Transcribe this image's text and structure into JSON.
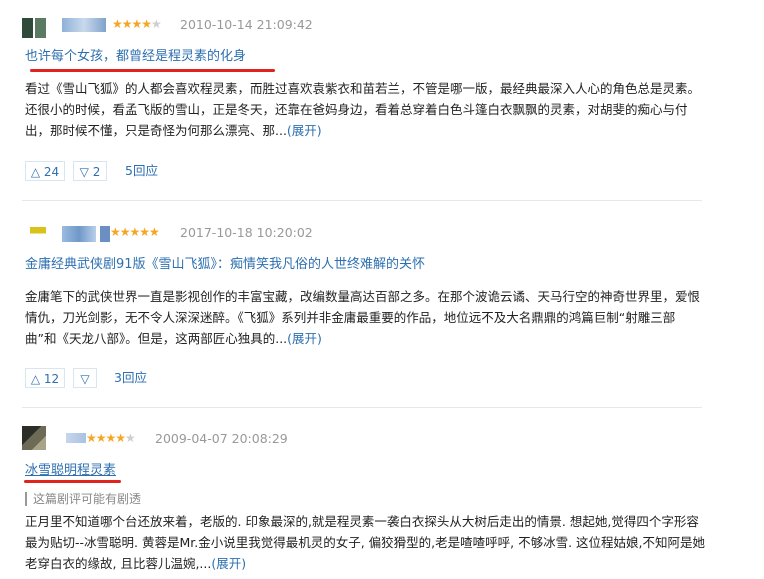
{
  "reviews": [
    {
      "rating": 4,
      "date": "2010-10-14 21:09:42",
      "title": "也许每个女孩，都曾经是程灵素的化身",
      "body": "看过《雪山飞狐》的人都会喜欢程灵素，而胜过喜欢袁紫衣和苗若兰，不管是哪一版，最经典最深入人心的角色总是灵素。还很小的时候，看孟飞版的雪山，正是冬天，还靠在爸妈身边，看着总穿着白色斗篷白衣飘飘的灵素，对胡斐的痴心与付出，那时候不懂，只是奇怪为何那么漂亮、那...",
      "expand": "(展开)",
      "up": "△ 24",
      "down": "▽ 2",
      "replies": "5回应"
    },
    {
      "rating": 5,
      "date": "2017-10-18 10:20:02",
      "title": "金庸经典武侠剧91版《雪山飞狐》：痴情笑我凡俗的人世终难解的关怀",
      "body": "金庸笔下的武侠世界一直是影视创作的丰富宝藏，改编数量高达百部之多。在那个波诡云谲、天马行空的神奇世界里，爱恨情仇，刀光剑影，无不令人深深迷醉。《飞狐》系列并非金庸最重要的作品，地位远不及大名鼎鼎的鸿篇巨制“射雕三部曲”和《天龙八部》。但是，这两部匠心独具的...",
      "expand": "(展开)",
      "up": "△ 12",
      "down": "▽",
      "replies": "3回应"
    },
    {
      "rating": 4,
      "date": "2009-04-07 20:08:29",
      "title": "冰雪聪明程灵素",
      "spoiler": "这篇剧评可能有剧透",
      "body": "正月里不知道哪个台还放来着，老版的. 印象最深的,就是程灵素一袭白衣探头从大树后走出的情景. 想起她,觉得四个字形容最为贴切--冰雪聪明. 黄蓉是Mr.金小说里我觉得最机灵的女子, 偏狡猾型的,老是喳喳呼呼, 不够冰雪. 这位程姑娘,不知阿是她老穿白衣的缘故, 且比蓉儿温婉,...",
      "expand": "(展开)"
    }
  ],
  "colors": {
    "link": "#2d6fb0",
    "star": "#f6a623",
    "highlight": "#e0231f"
  },
  "icons": {
    "star": "star-icon",
    "up": "thumbs-up-icon",
    "down": "thumbs-down-icon"
  }
}
